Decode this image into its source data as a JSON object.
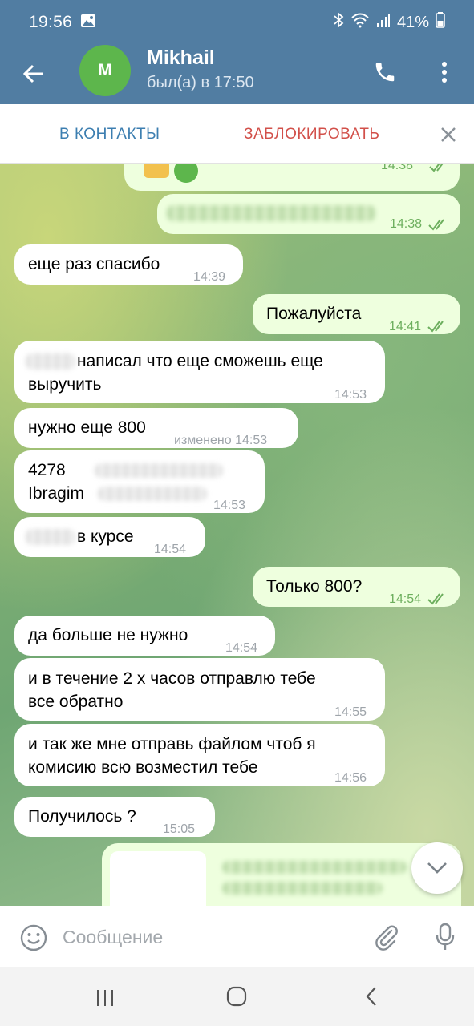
{
  "status_bar": {
    "time": "19:56",
    "battery": "41%",
    "icons": [
      "gallery-icon",
      "bluetooth-icon",
      "wifi-icon",
      "signal-icon",
      "battery-icon"
    ]
  },
  "header": {
    "avatar_letter": "M",
    "avatar_color": "#5DB64C",
    "contact_name": "Mikhail",
    "last_seen": "был(а) в 17:50",
    "icons": [
      "back-arrow-icon",
      "phone-icon",
      "more-vert-icon"
    ]
  },
  "action_bar": {
    "add_contact": "В КОНТАКТЫ",
    "block": "ЗАБЛОКИРОВАТЬ",
    "close_icon": "close-icon"
  },
  "colors": {
    "header_bg": "#517DA2",
    "incoming_bubble": "#FFFFFF",
    "outgoing_bubble": "#EEFFDE",
    "outgoing_time": "#6DAF5E",
    "block_text": "#D2504A",
    "add_contact_text": "#3C7EB0"
  },
  "messages": [
    {
      "dir": "out",
      "lines": [
        ""
      ],
      "time": "14:38",
      "read": true,
      "note": ""
    },
    {
      "dir": "out",
      "lines": [
        ""
      ],
      "time": "14:38",
      "read": true
    },
    {
      "dir": "in",
      "lines": [
        "еще раз спасибо"
      ],
      "time": "14:39"
    },
    {
      "dir": "out",
      "lines": [
        "Пожалуйста"
      ],
      "time": "14:41",
      "read": true
    },
    {
      "dir": "in",
      "lines": [
        "написал что еще сможешь еще",
        "выручить"
      ],
      "time": "14:53"
    },
    {
      "dir": "in",
      "lines": [
        "нужно еще 800"
      ],
      "time": "изменено 14:53"
    },
    {
      "dir": "in",
      "lines": [
        "4278",
        "Ibragim"
      ],
      "time": "14:53"
    },
    {
      "dir": "in",
      "lines": [
        "в курсе"
      ],
      "time": "14:54"
    },
    {
      "dir": "out",
      "lines": [
        "Только 800?"
      ],
      "time": "14:54",
      "read": true
    },
    {
      "dir": "in",
      "lines": [
        "да больше не нужно"
      ],
      "time": "14:54"
    },
    {
      "dir": "in",
      "lines": [
        "и в течение 2 х часов отправлю тебе",
        "все обратно"
      ],
      "time": "14:55"
    },
    {
      "dir": "in",
      "lines": [
        "и так же мне отправь файлом чтоб я",
        "комисию всю возместил тебе"
      ],
      "time": "14:56"
    },
    {
      "dir": "in",
      "lines": [
        "Получилось ?"
      ],
      "time": "15:05"
    }
  ],
  "input": {
    "placeholder": "Сообщение",
    "value": "",
    "icons": [
      "emoji-icon",
      "attach-icon",
      "mic-icon"
    ]
  },
  "nav": {
    "icons": [
      "recents-icon",
      "home-icon",
      "nav-back-icon"
    ]
  }
}
